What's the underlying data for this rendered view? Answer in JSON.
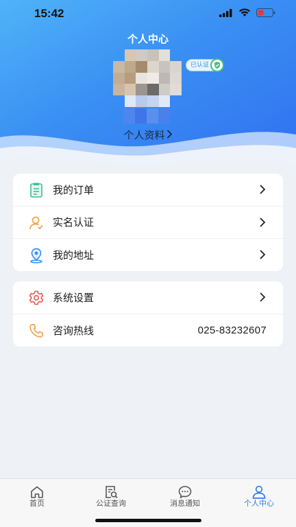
{
  "status_bar": {
    "time": "15:42"
  },
  "header": {
    "title": "个人中心",
    "verified_label": "已认证",
    "profile_link": "个人资料",
    "profile_chevron": "›"
  },
  "menu_group_1": [
    {
      "label": "我的订单",
      "icon": "order-clipboard-icon"
    },
    {
      "label": "实名认证",
      "icon": "user-verify-icon"
    },
    {
      "label": "我的地址",
      "icon": "location-pin-icon"
    }
  ],
  "menu_group_2": [
    {
      "label": "系统设置",
      "icon": "gear-icon"
    },
    {
      "label": "咨询热线",
      "icon": "phone-icon",
      "value": "025-83232607"
    }
  ],
  "tabbar": [
    {
      "label": "首页",
      "icon": "home-icon"
    },
    {
      "label": "公证查询",
      "icon": "document-search-icon"
    },
    {
      "label": "消息通知",
      "icon": "chat-bubble-icon"
    },
    {
      "label": "个人中心",
      "icon": "user-icon",
      "active": true
    }
  ],
  "colors": {
    "header_gradient_start": "#4fb3f8",
    "header_gradient_end": "#2f6ff0",
    "active_tab": "#2f7cf0",
    "page_background": "#eef1f5"
  }
}
